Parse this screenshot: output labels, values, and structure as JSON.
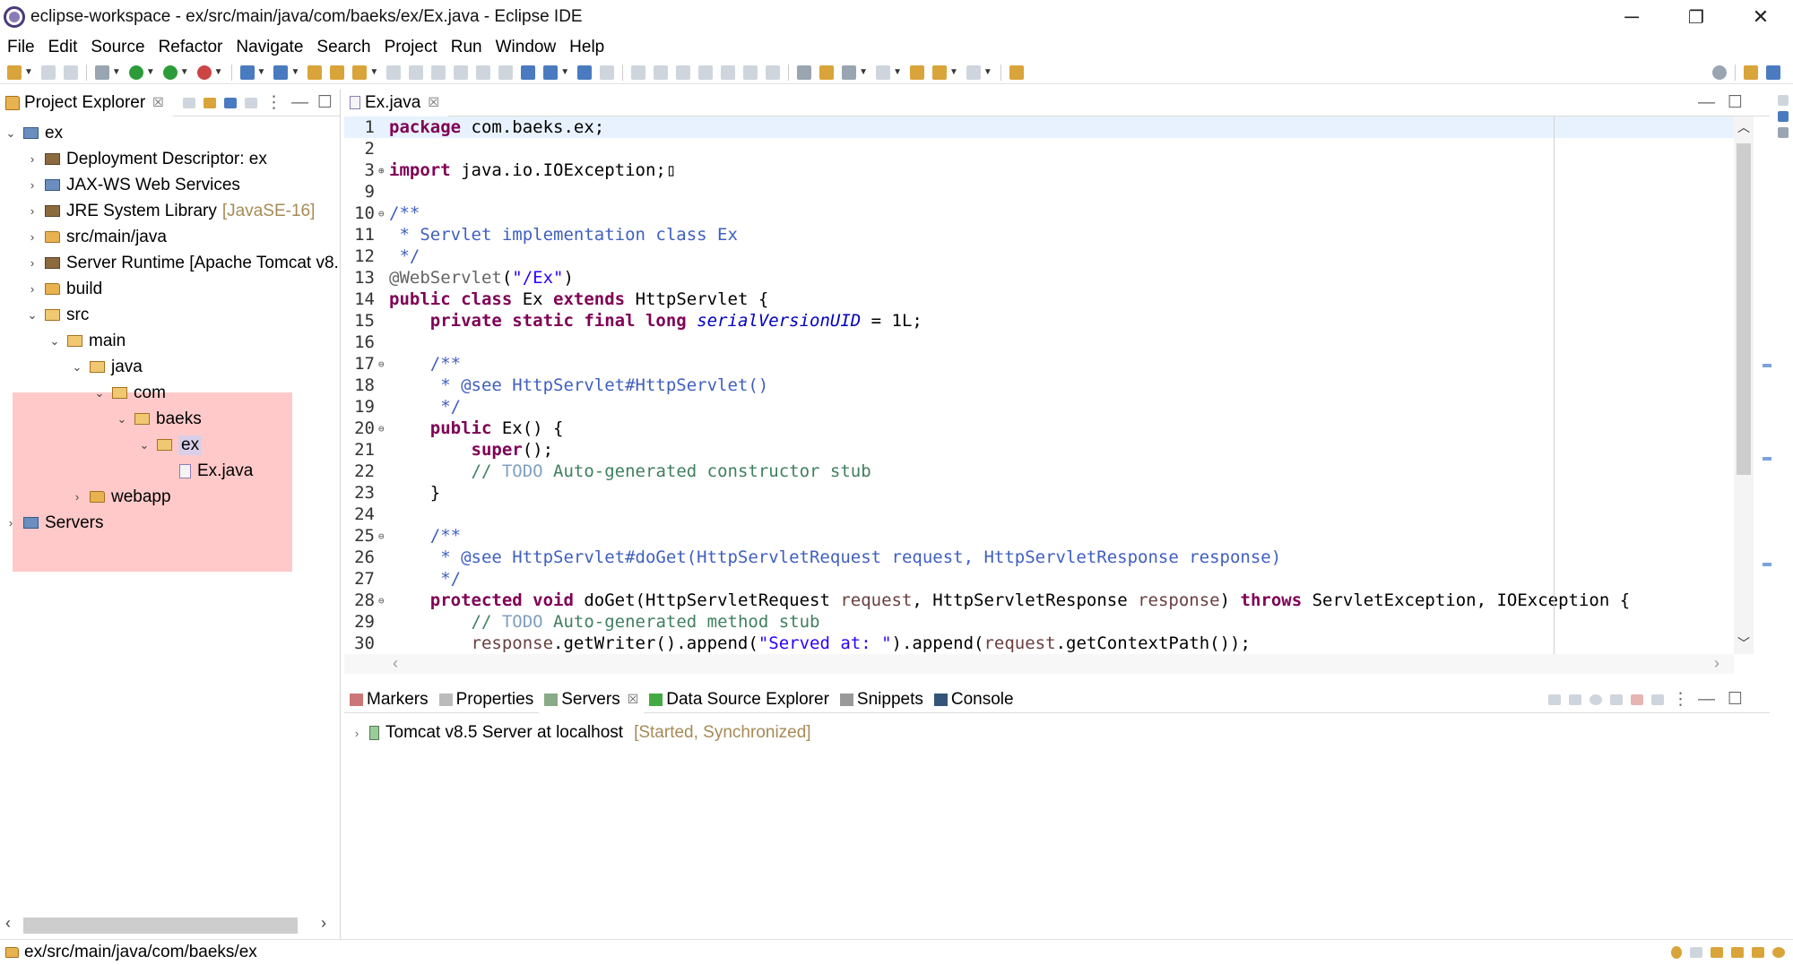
{
  "window": {
    "title": "eclipse-workspace - ex/src/main/java/com/baeks/ex/Ex.java - Eclipse IDE",
    "minimize": "─",
    "restore": "❐",
    "close": "✕"
  },
  "menu": [
    "File",
    "Edit",
    "Source",
    "Refactor",
    "Navigate",
    "Search",
    "Project",
    "Run",
    "Window",
    "Help"
  ],
  "explorer": {
    "tab_label": "Project Explorer",
    "tab_close": "☒",
    "tree": [
      {
        "label": "ex",
        "chev": "⌄",
        "icon": "project"
      },
      {
        "label": "Deployment Descriptor: ex",
        "chev": "›",
        "icon": "descriptor"
      },
      {
        "label": "JAX-WS Web Services",
        "chev": "›",
        "icon": "webservices"
      },
      {
        "label": "JRE System Library",
        "deco": "[JavaSE-16]",
        "chev": "›",
        "icon": "library"
      },
      {
        "label": "src/main/java",
        "chev": "›",
        "icon": "package-folder"
      },
      {
        "label": "Server Runtime [Apache Tomcat v8.",
        "chev": "›",
        "icon": "library"
      },
      {
        "label": "build",
        "chev": "›",
        "icon": "folder"
      },
      {
        "label": "src",
        "chev": "⌄",
        "icon": "folder-open"
      },
      {
        "label": "main",
        "chev": "⌄",
        "icon": "folder-open"
      },
      {
        "label": "java",
        "chev": "⌄",
        "icon": "folder-open"
      },
      {
        "label": "com",
        "chev": "⌄",
        "icon": "folder-open"
      },
      {
        "label": "baeks",
        "chev": "⌄",
        "icon": "folder-open"
      },
      {
        "label": "ex",
        "chev": "⌄",
        "icon": "folder-open"
      },
      {
        "label": "Ex.java",
        "chev": "",
        "icon": "java-file"
      },
      {
        "label": "webapp",
        "chev": "›",
        "icon": "folder"
      },
      {
        "label": "Servers",
        "chev": "›",
        "icon": "project"
      }
    ]
  },
  "editor": {
    "tab_label": "Ex.java",
    "tab_close": "☒",
    "lines": [
      {
        "n": "1",
        "mk": "",
        "html": "<span class=\"kw\">package</span> com.baeks.ex;",
        "cur": true
      },
      {
        "n": "2",
        "mk": "",
        "html": ""
      },
      {
        "n": "3",
        "mk": "⊕",
        "html": "<span class=\"kw\">import</span> java.io.IOException;▯"
      },
      {
        "n": "9",
        "mk": "",
        "html": ""
      },
      {
        "n": "10",
        "mk": "⊖",
        "html": "<span class=\"jd\">/**</span>"
      },
      {
        "n": "11",
        "mk": "",
        "html": "<span class=\"jd\"> * Servlet implementation class Ex</span>"
      },
      {
        "n": "12",
        "mk": "",
        "html": "<span class=\"jd\"> */</span>"
      },
      {
        "n": "13",
        "mk": "",
        "html": "<span class=\"ann\">@WebServlet</span>(<span class=\"str\">\"/Ex\"</span>)"
      },
      {
        "n": "14",
        "mk": "",
        "html": "<span class=\"kw\">public class</span> Ex <span class=\"kw\">extends</span> HttpServlet {"
      },
      {
        "n": "15",
        "mk": "",
        "html": "    <span class=\"kw\">private static final long</span> <span class=\"fld\">serialVersionUID</span> = 1L;"
      },
      {
        "n": "16",
        "mk": "",
        "html": ""
      },
      {
        "n": "17",
        "mk": "⊖",
        "html": "    <span class=\"jd\">/**</span>"
      },
      {
        "n": "18",
        "mk": "",
        "html": "<span class=\"jd\">     * @see HttpServlet#HttpServlet()</span>"
      },
      {
        "n": "19",
        "mk": "",
        "html": "<span class=\"jd\">     */</span>"
      },
      {
        "n": "20",
        "mk": "⊖",
        "html": "    <span class=\"kw\">public</span> Ex() {"
      },
      {
        "n": "21",
        "mk": "",
        "html": "        <span class=\"kw\">super</span>();"
      },
      {
        "n": "22",
        "mk": "",
        "html": "        <span class=\"cm\">// </span><span class=\"todo\">TODO</span><span class=\"cm\"> Auto-generated constructor stub</span>"
      },
      {
        "n": "23",
        "mk": "",
        "html": "    }"
      },
      {
        "n": "24",
        "mk": "",
        "html": ""
      },
      {
        "n": "25",
        "mk": "⊖",
        "html": "    <span class=\"jd\">/**</span>"
      },
      {
        "n": "26",
        "mk": "",
        "html": "<span class=\"jd\">     * @see HttpServlet#doGet(HttpServletRequest request, HttpServletResponse response)</span>"
      },
      {
        "n": "27",
        "mk": "",
        "html": "<span class=\"jd\">     */</span>"
      },
      {
        "n": "28",
        "mk": "⊖",
        "html": "    <span class=\"kw\">protected void</span> doGet(HttpServletRequest <span class=\"par\">request</span>, HttpServletResponse <span class=\"par\">response</span>) <span class=\"kw\">throws</span> ServletException, IOException {"
      },
      {
        "n": "29",
        "mk": "",
        "html": "        <span class=\"cm\">// </span><span class=\"todo\">TODO</span><span class=\"cm\"> Auto-generated method stub</span>"
      },
      {
        "n": "30",
        "mk": "",
        "html": "        <span class=\"par\">response</span>.getWriter().append(<span class=\"str\">\"Served at: \"</span>).append(<span class=\"par\">request</span>.getContextPath());"
      }
    ]
  },
  "bottom": {
    "tabs": [
      "Markers",
      "Properties",
      "Servers",
      "Data Source Explorer",
      "Snippets",
      "Console"
    ],
    "server_label": "Tomcat v8.5 Server at localhost",
    "server_status": "[Started, Synchronized]"
  },
  "status": {
    "path": "ex/src/main/java/com/baeks/ex"
  }
}
